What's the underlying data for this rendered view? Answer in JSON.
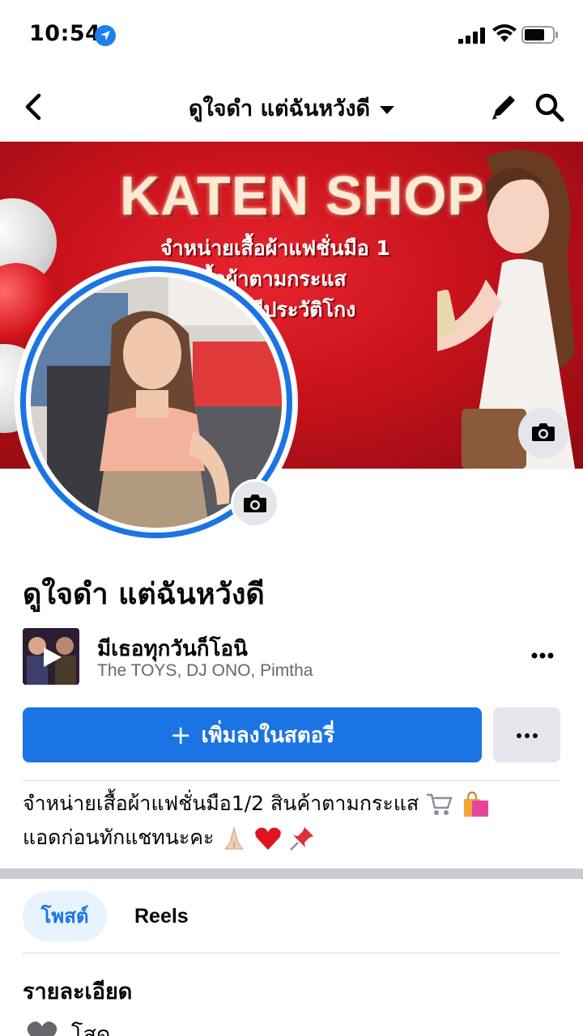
{
  "status_bar": {
    "time": "10:54"
  },
  "nav": {
    "title": "ดูใจดำ แต่ฉันหวังดี"
  },
  "cover": {
    "title": "KATEN SHOP",
    "lines": [
      "จำหน่ายเสื้อผ้าแฟชั่นมือ 1",
      "เสื้อผ้าตามกระแส",
      "ไม่มีประวัติโกง"
    ]
  },
  "profile": {
    "name": "ดูใจดำ แต่ฉันหวังดี"
  },
  "music": {
    "title": "มีเธอทุกวันก็โอนิ",
    "artist": "The TOYS, DJ ONO, Pimtha"
  },
  "actions": {
    "add_story_plus": "+",
    "add_story_label": "เพิ่มลงในสตอรี่"
  },
  "bio": {
    "line1": "จำหน่ายเสื้อผ้าแฟชั่นมือ1/2 สินค้าตามกระแส",
    "line2": "แอดก่อนทักแชทนะคะ"
  },
  "tabs": {
    "posts": "โพสต์",
    "reels": "Reels"
  },
  "details": {
    "heading": "รายละเอียด",
    "relationship": "โสด"
  },
  "colors": {
    "accent": "#1b74e4",
    "cover_red": "#c8121c",
    "secondary_text": "#65676b"
  },
  "icons": [
    "location-arrow-icon",
    "signal-icon",
    "wifi-icon",
    "battery-icon",
    "back-icon",
    "pencil-icon",
    "search-icon",
    "camera-icon",
    "play-icon",
    "more-dots-icon",
    "heart-icon"
  ]
}
